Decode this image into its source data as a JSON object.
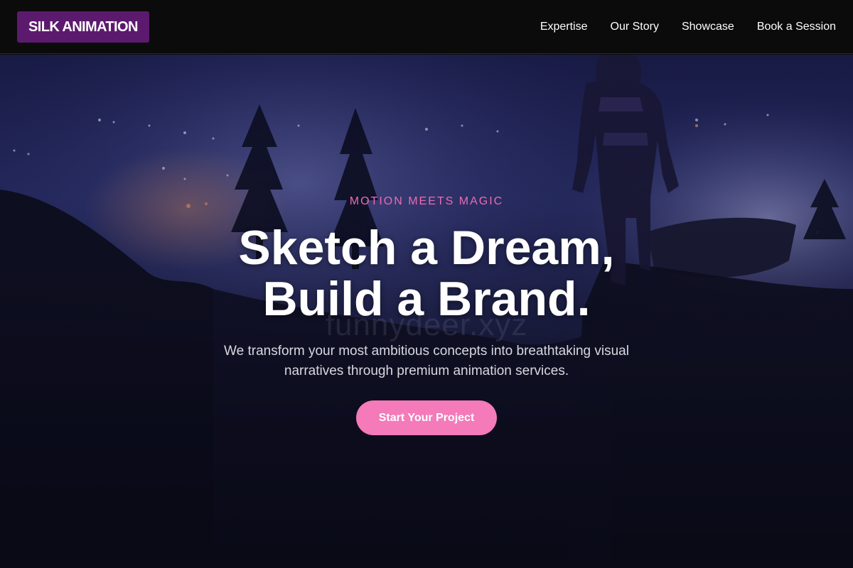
{
  "header": {
    "logo_text": "SILK ANIMATION",
    "nav": [
      {
        "label": "Expertise"
      },
      {
        "label": "Our Story"
      },
      {
        "label": "Showcase"
      },
      {
        "label": "Book a Session"
      }
    ]
  },
  "hero": {
    "eyebrow": "MOTION MEETS MAGIC",
    "headline_line1": "Sketch a Dream,",
    "headline_line2": "Build a Brand.",
    "watermark": "funnydeer.xyz",
    "subtext": "We transform your most ambitious concepts into breathtaking visual narratives through premium animation services.",
    "cta_label": "Start Your Project",
    "background_icon": "night-landscape-astronaut-image"
  },
  "colors": {
    "logo_bg": "#5c1a6e",
    "accent_pink": "#f06aaf",
    "cta_bg": "#f47ab9",
    "header_bg": "#0b0b0b"
  }
}
